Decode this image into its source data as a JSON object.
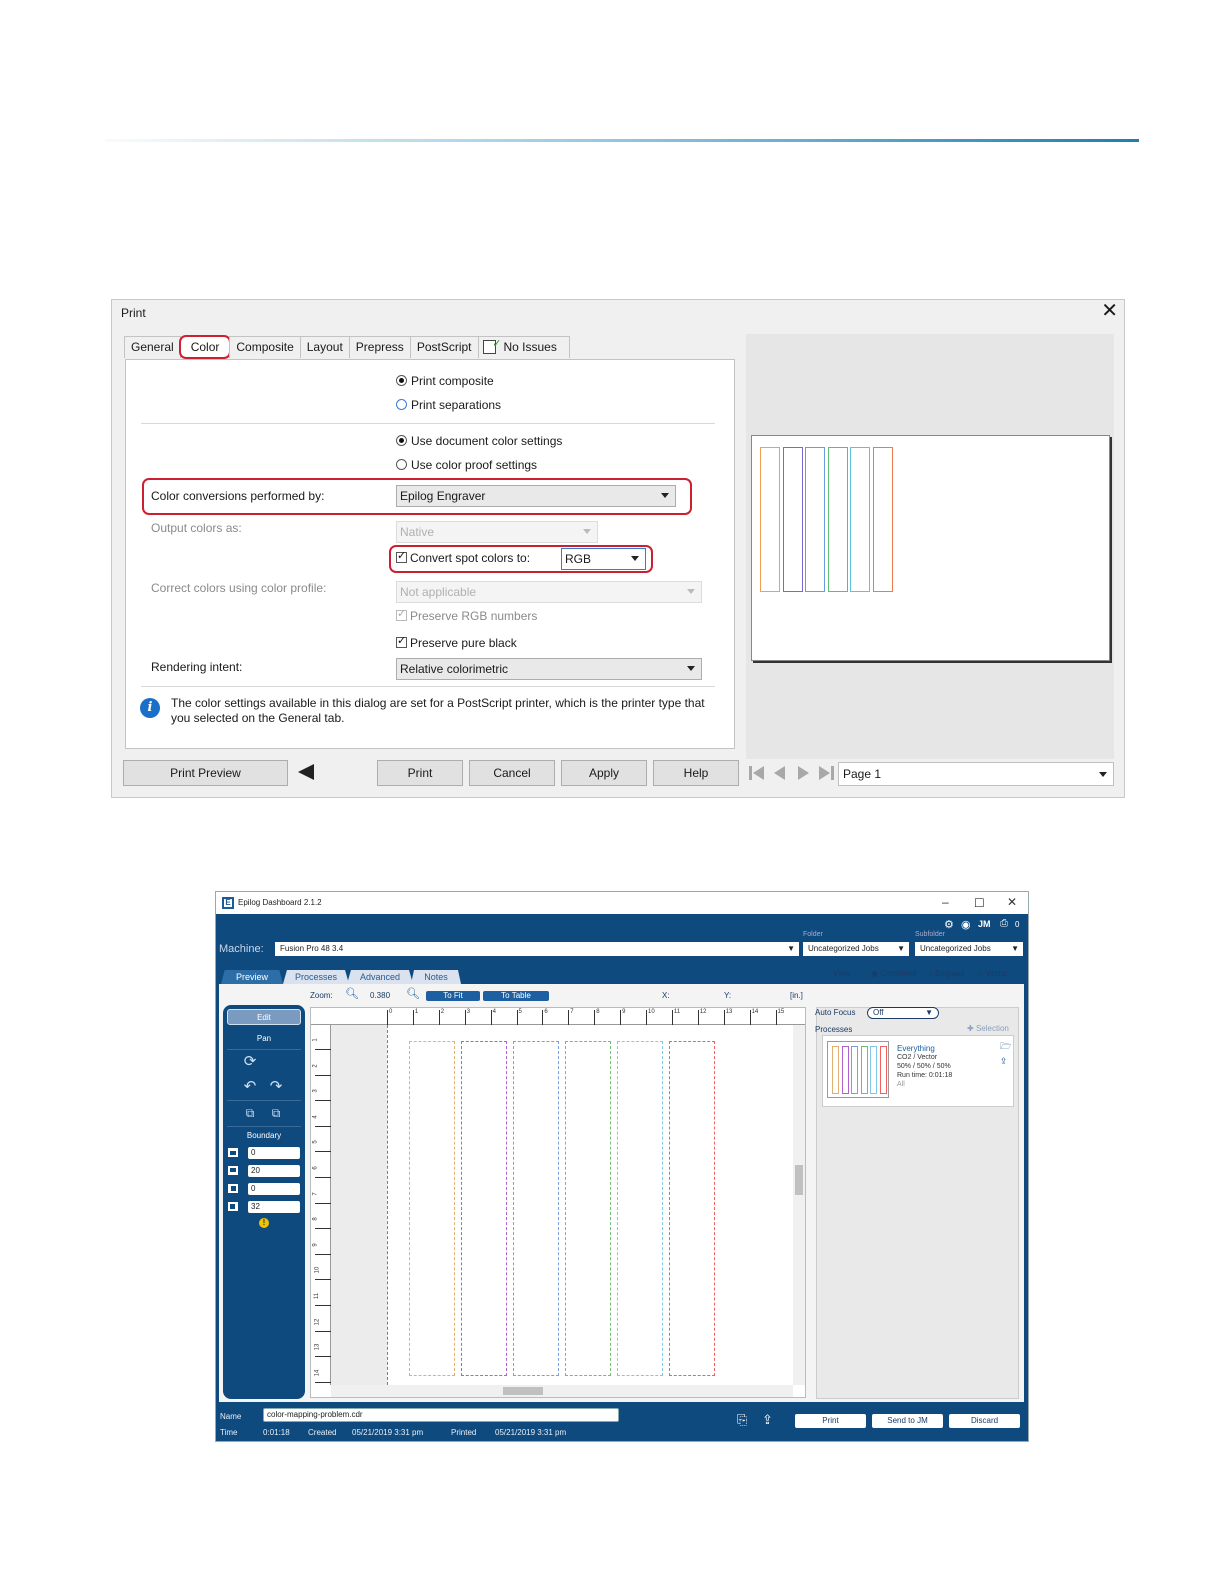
{
  "print_dialog": {
    "title": "Print",
    "tabs": [
      {
        "label": "General"
      },
      {
        "label": "Color"
      },
      {
        "label": "Composite"
      },
      {
        "label": "Layout"
      },
      {
        "label": "Prepress"
      },
      {
        "label": "PostScript"
      },
      {
        "label": "No Issues"
      }
    ],
    "active_tab": "Color",
    "print_composite": "Print composite",
    "print_separations": "Print separations",
    "use_document_color": "Use document color settings",
    "use_color_proof": "Use color proof settings",
    "color_conversions_label": "Color conversions performed by:",
    "color_conversions_value": "Epilog Engraver",
    "output_colors_label": "Output colors as:",
    "output_colors_value": "Native",
    "convert_spot_label": "Convert spot colors to:",
    "convert_spot_value": "RGB",
    "correct_colors_label": "Correct colors using color profile:",
    "correct_colors_value": "Not applicable",
    "preserve_rgb": "Preserve RGB numbers",
    "preserve_black": "Preserve pure black",
    "rendering_intent_label": "Rendering intent:",
    "rendering_intent_value": "Relative colorimetric",
    "info_line1": "The color settings available in this dialog are set for a PostScript printer, which is the printer type that",
    "info_line2": "you selected on the General tab.",
    "buttons": {
      "print_preview": "Print Preview",
      "print": "Print",
      "cancel": "Cancel",
      "apply": "Apply",
      "help": "Help"
    },
    "page_selector": "Page 1",
    "preview_colors": [
      "#f0a050",
      "#7a6ad0",
      "#6a9ae0",
      "#5cc070",
      "#60c0e0",
      "#f07a50"
    ]
  },
  "dashboard": {
    "title": "Epilog Dashboard 2.1.2",
    "machine_label": "Machine:",
    "machine_value": "Fusion Pro 48 3.4",
    "folder_label": "Folder",
    "folder_value": "Uncategorized Jobs",
    "subfolder_label": "Subfolder",
    "subfolder_value": "Uncategorized Jobs",
    "status_count_1": "0",
    "status_count_2": "0",
    "tabs": [
      "Preview",
      "Processes",
      "Advanced",
      "Notes"
    ],
    "view_label": "View:",
    "view_options": [
      "Combined",
      "Engrave",
      "Vector"
    ],
    "zoom_label": "Zoom:",
    "zoom_value": "0.380",
    "to_fit": "To Fit",
    "to_table": "To Table",
    "x_label": "X:",
    "y_label": "Y:",
    "unit": "[in.]",
    "edit_label": "Edit",
    "pan_label": "Pan",
    "boundary_label": "Boundary",
    "boundary_values": [
      "0",
      "20",
      "0",
      "32"
    ],
    "ruler_top": [
      "0",
      "1",
      "2",
      "3",
      "4",
      "5",
      "6",
      "7",
      "8",
      "9",
      "10",
      "11",
      "12",
      "13",
      "14",
      "15"
    ],
    "ruler_left": [
      "1",
      "2",
      "3",
      "4",
      "5",
      "6",
      "7",
      "8",
      "9",
      "10",
      "11",
      "12",
      "13",
      "14"
    ],
    "auto_focus_label": "Auto Focus",
    "auto_focus_value": "Off",
    "processes_label": "Processes",
    "selection_label": "Selection",
    "process": {
      "name": "Everything",
      "type": "CO2 / Vector",
      "settings": "50% / 50% / 50%",
      "run_time": "Run time: 0:01:18",
      "scope": "All"
    },
    "footer": {
      "name_label": "Name",
      "name_value": "color-mapping-problem.cdr",
      "time_label": "Time",
      "time_value": "0:01:18",
      "created_label": "Created",
      "created_value": "05/21/2019 3:31 pm",
      "printed_label": "Printed",
      "printed_value": "05/21/2019 3:31 pm",
      "print_button": "Print",
      "send_button": "Send to JM",
      "discard_button": "Discard"
    },
    "canvas_colors": [
      "#e0b070",
      "#b060d0",
      "#7aa0e0",
      "#70c070",
      "#80c8e8",
      "#f06060"
    ]
  }
}
